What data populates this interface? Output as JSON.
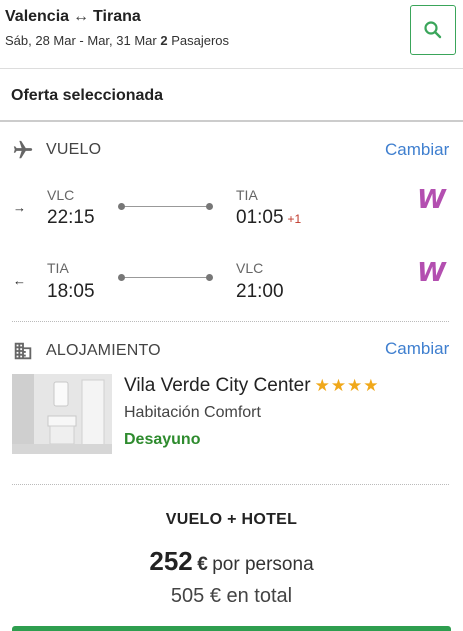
{
  "header": {
    "origin": "Valencia",
    "destination": "Tirana",
    "dates": "Sáb, 28 Mar - Mar, 31 Mar",
    "passengers_count": "2",
    "passengers_label": "Pasajeros"
  },
  "offer": {
    "title": "Oferta seleccionada"
  },
  "flight": {
    "section_label": "VUELO",
    "change_label": "Cambiar",
    "airline_logo_text": "W",
    "legs": [
      {
        "direction": "→",
        "dep_code": "VLC",
        "dep_time": "22:15",
        "arr_code": "TIA",
        "arr_time": "01:05",
        "day_offset": "+1"
      },
      {
        "direction": "←",
        "dep_code": "TIA",
        "dep_time": "18:05",
        "arr_code": "VLC",
        "arr_time": "21:00",
        "day_offset": ""
      }
    ]
  },
  "hotel": {
    "section_label": "ALOJAMIENTO",
    "change_label": "Cambiar",
    "name": "Vila Verde City Center",
    "stars": "★★★★",
    "star_rating": 4,
    "room": "Habitación Comfort",
    "board": "Desayuno"
  },
  "price": {
    "package_label": "VUELO + HOTEL",
    "per_person_amount": "252",
    "currency": "€",
    "per_person_label": "por persona",
    "total_amount": "505",
    "total_label": "en total"
  },
  "colors": {
    "accent_green": "#3aa55a",
    "link_blue": "#3f7fcf",
    "star_gold": "#f0a81a",
    "airline_purple": "#b34fb0",
    "day_offset_red": "#c0392b"
  }
}
